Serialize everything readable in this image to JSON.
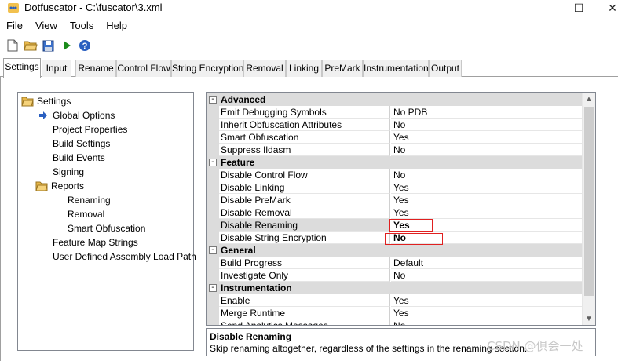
{
  "window": {
    "title": "Dotfuscator - C:\\fuscator\\3.xml",
    "minimize_glyph": "—",
    "maximize_glyph": "☐",
    "close_glyph": "✕"
  },
  "menu": [
    "File",
    "View",
    "Tools",
    "Help"
  ],
  "toolbar": {
    "buttons": [
      "new-file-icon",
      "open-folder-icon",
      "save-icon",
      "run-icon",
      "help-icon"
    ]
  },
  "tabs": [
    {
      "label": "Settings",
      "active": true
    },
    {
      "label": "Input"
    },
    {
      "label": "Rename"
    },
    {
      "label": "Control Flow"
    },
    {
      "label": "String Encryption"
    },
    {
      "label": "Removal"
    },
    {
      "label": "Linking"
    },
    {
      "label": "PreMark"
    },
    {
      "label": "Instrumentation"
    },
    {
      "label": "Output"
    }
  ],
  "tree": [
    {
      "label": "Settings",
      "icon": "folder-open-icon",
      "level": 0
    },
    {
      "label": "Global Options",
      "icon": "arrow-right-icon",
      "level": 1
    },
    {
      "label": "Project Properties",
      "level": 1
    },
    {
      "label": "Build Settings",
      "level": 1
    },
    {
      "label": "Build Events",
      "level": 1
    },
    {
      "label": "Signing",
      "level": 1
    },
    {
      "label": "Reports",
      "icon": "folder-open-icon",
      "level": 1
    },
    {
      "label": "Renaming",
      "level": 2
    },
    {
      "label": "Removal",
      "level": 2
    },
    {
      "label": "Smart Obfuscation",
      "level": 2
    },
    {
      "label": "Feature Map Strings",
      "level": 1
    },
    {
      "label": "User Defined Assembly Load Path",
      "level": 1
    }
  ],
  "grid": {
    "categories": [
      {
        "name": "Advanced",
        "expander": "-",
        "props": [
          {
            "name": "Emit Debugging Symbols",
            "value": "No PDB"
          },
          {
            "name": "Inherit Obfuscation Attributes",
            "value": "No"
          },
          {
            "name": "Smart Obfuscation",
            "value": "Yes"
          },
          {
            "name": "Suppress Ildasm",
            "value": "No"
          }
        ]
      },
      {
        "name": "Feature",
        "expander": "-",
        "props": [
          {
            "name": "Disable Control Flow",
            "value": "No"
          },
          {
            "name": "Disable Linking",
            "value": "Yes"
          },
          {
            "name": "Disable PreMark",
            "value": "Yes"
          },
          {
            "name": "Disable Removal",
            "value": "Yes"
          },
          {
            "name": "Disable Renaming",
            "value": "Yes",
            "selected": true,
            "bold": true
          },
          {
            "name": "Disable String Encryption",
            "value": "No",
            "bold": true
          }
        ]
      },
      {
        "name": "General",
        "expander": "-",
        "props": [
          {
            "name": "Build Progress",
            "value": "Default"
          },
          {
            "name": "Investigate Only",
            "value": "No"
          }
        ]
      },
      {
        "name": "Instrumentation",
        "expander": "-",
        "props": [
          {
            "name": "Enable",
            "value": "Yes"
          },
          {
            "name": "Merge Runtime",
            "value": "Yes"
          },
          {
            "name": "Send Analytics Messages",
            "value": "No"
          }
        ]
      }
    ],
    "scroll_up_glyph": "▲",
    "scroll_down_glyph": "▼"
  },
  "description": {
    "title": "Disable Renaming",
    "text": "Skip renaming altogether, regardless of the settings in the renaming section."
  },
  "watermark": "CSDN @俱会一处",
  "colors": {
    "highlight_box": "#e02020",
    "category_bg": "#dcdcdc",
    "run_icon": "#1a8a1a",
    "help_icon": "#2a5fc0"
  }
}
